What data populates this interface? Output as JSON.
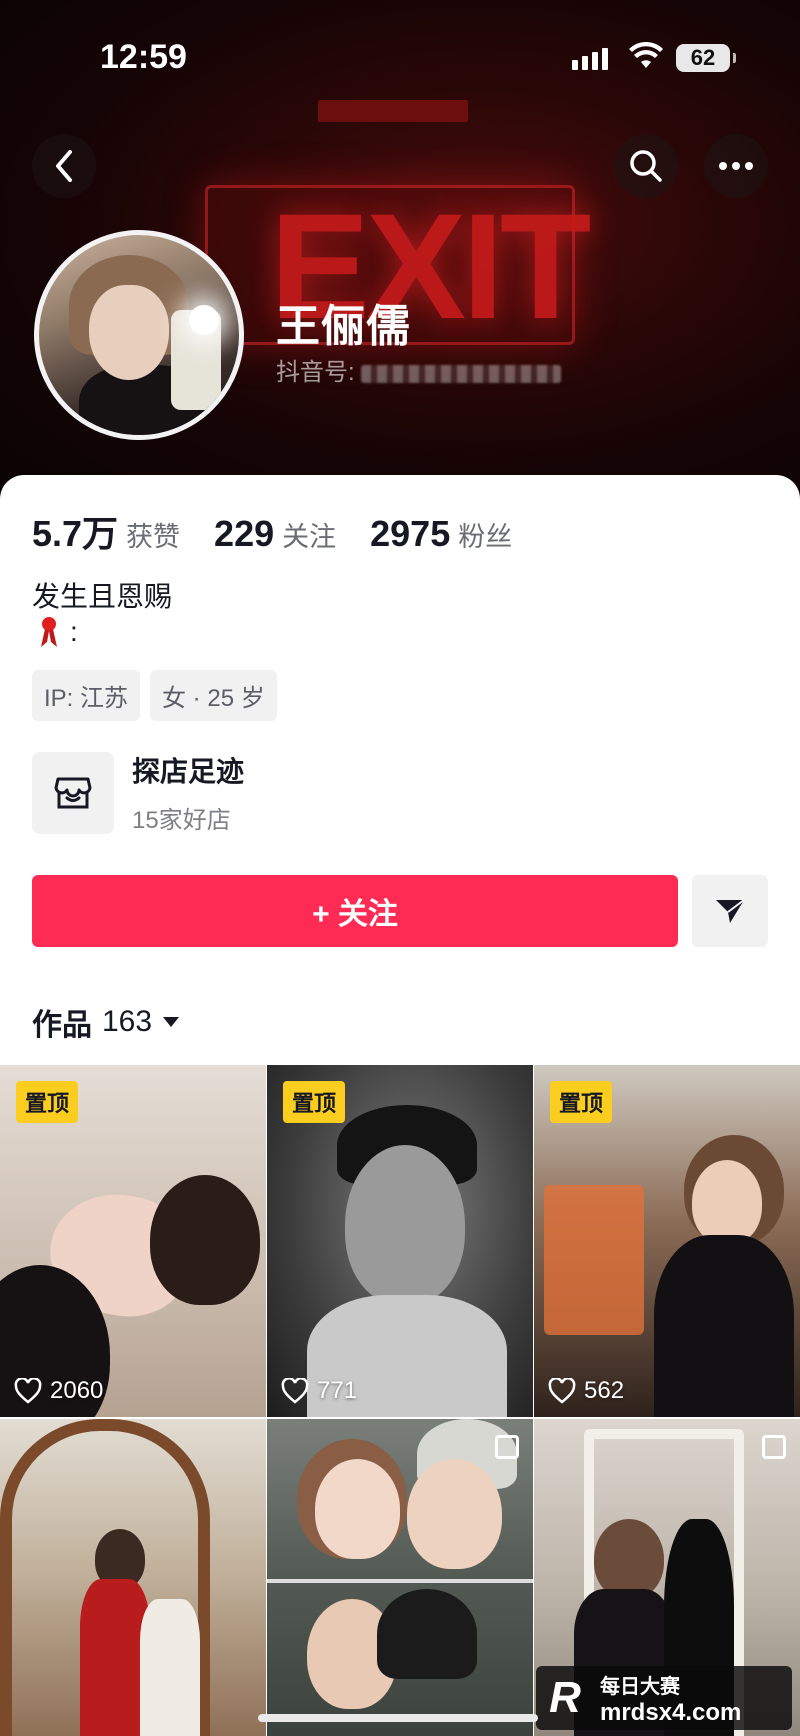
{
  "status_bar": {
    "time": "12:59",
    "battery": "62"
  },
  "profile": {
    "name": "王俪儒",
    "douyin_id_label": "抖音号:"
  },
  "stats": [
    {
      "value": "5.7万",
      "label": "获赞"
    },
    {
      "value": "229",
      "label": "关注"
    },
    {
      "value": "2975",
      "label": "粉丝"
    }
  ],
  "bio": {
    "line1": "发生且恩赐",
    "line2": ":"
  },
  "tags": [
    "IP: 江苏",
    "女 · 25 岁"
  ],
  "shop": {
    "title": "探店足迹",
    "subtitle": "15家好店"
  },
  "follow_label": "+ 关注",
  "works": {
    "label": "作品",
    "count": "163"
  },
  "grid": [
    {
      "pinned": true,
      "pin_label": "置顶",
      "likes": "2060"
    },
    {
      "pinned": true,
      "pin_label": "置顶",
      "likes": "771"
    },
    {
      "pinned": true,
      "pin_label": "置顶",
      "likes": "562"
    },
    {
      "pinned": false
    },
    {
      "pinned": false,
      "multi": true
    },
    {
      "pinned": false,
      "multi": true
    }
  ],
  "watermark": {
    "logo": "R",
    "cn": "每日大赛",
    "url": "mrdsx4.com"
  },
  "colors": {
    "accent": "#fe2c55",
    "pin": "#facd1f"
  },
  "cover": {
    "sign_text": "EXIT"
  }
}
